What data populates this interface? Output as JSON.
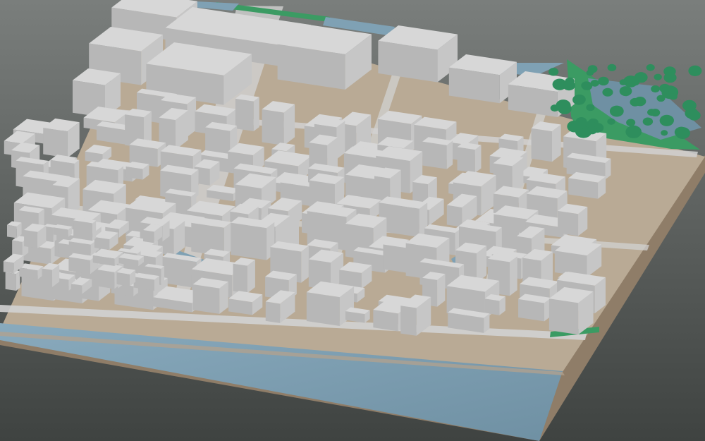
{
  "view": {
    "type": "3d-city-model",
    "projection": "isometric-oblique",
    "visible_text": []
  },
  "colors": {
    "background_top": "#7a7e7c",
    "background_bottom": "#3f4341",
    "base_side": "#8f7d68",
    "ground": "#b9aa95",
    "building_top": "#d7d7d7",
    "building_left": "#b7b7b7",
    "building_right": "#c6c6c6",
    "water": "#7fa1b4",
    "water_dark": "#6f90a3",
    "park": "#3b9b63",
    "tree": "#2e8e5d",
    "road": "#d1d1d1"
  },
  "icons": {
    "tree": "tree-icon"
  }
}
